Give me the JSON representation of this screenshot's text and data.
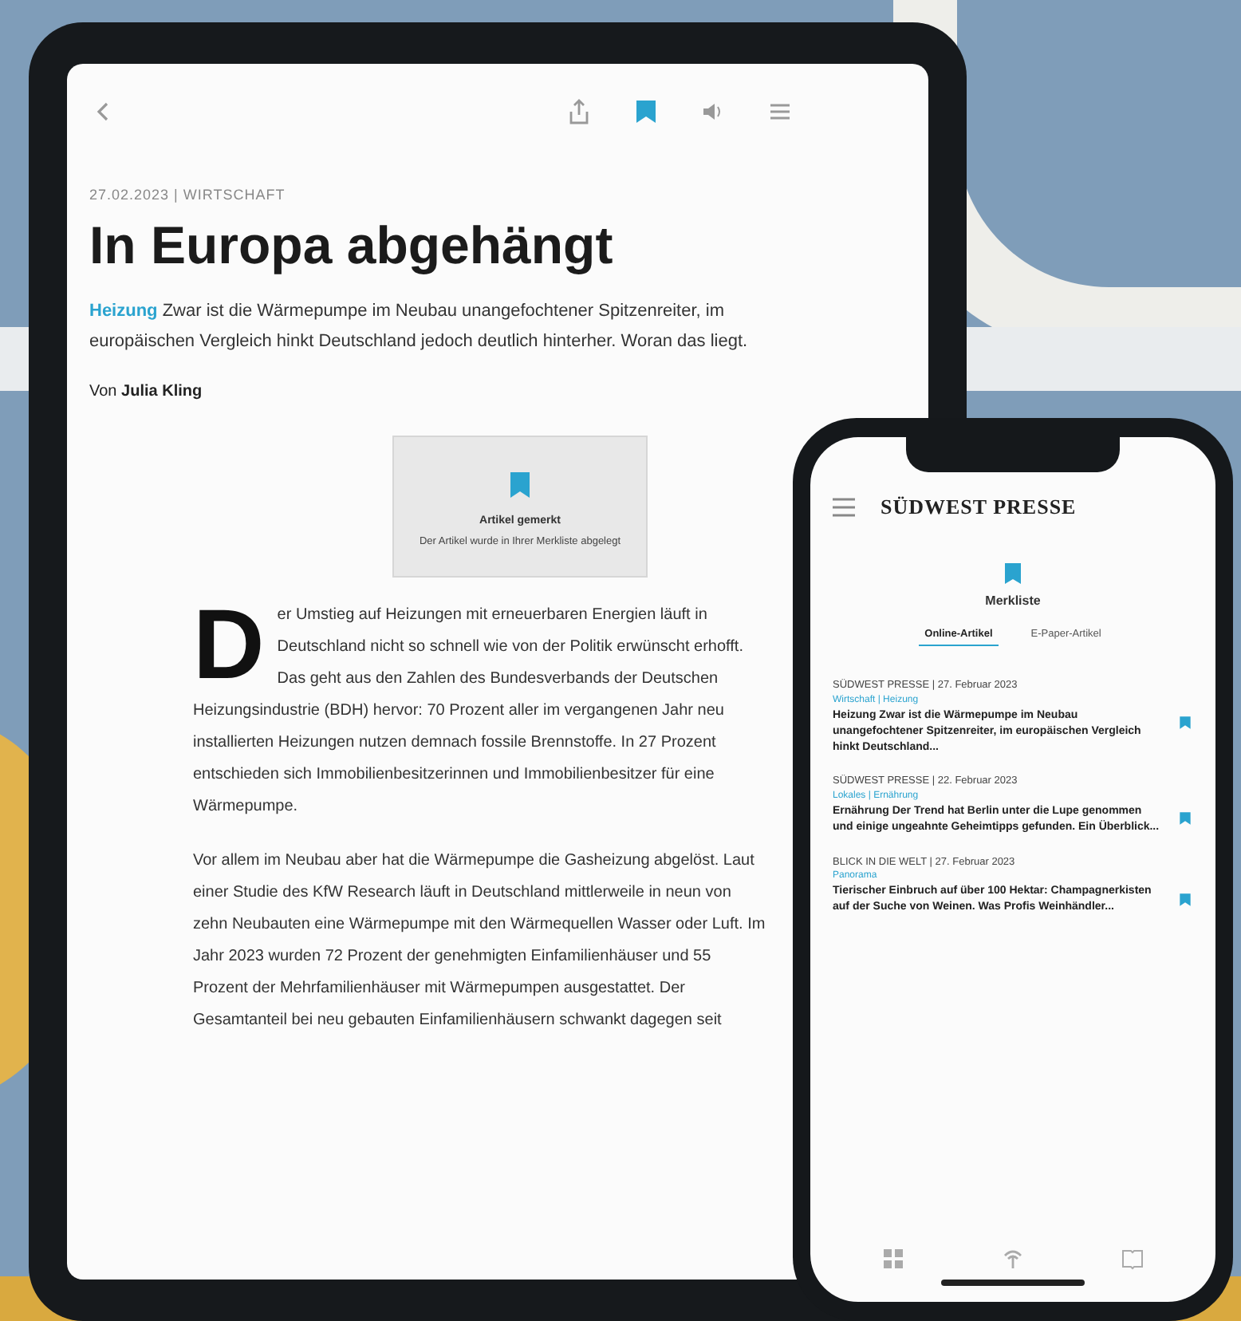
{
  "tablet": {
    "article": {
      "meta": "27.02.2023 | WIRTSCHAFT",
      "title": "In Europa abgehängt",
      "lead_tag": "Heizung",
      "lead": "Zwar ist die Wärmepumpe im Neubau unangefochtener Spitzenreiter, im europäischen Vergleich hinkt Deutschland jedoch deutlich hinterher. Woran das liegt.",
      "author": "Von **Julia Kling**",
      "toast": {
        "title": "Artikel gemerkt",
        "text": "Der Artikel wurde in Ihrer Merkliste abgelegt"
      },
      "dropcap": "D",
      "paragraphs": [
        "er Umstieg auf Heizungen mit erneuerbaren Energien läuft in Deutschland nicht so schnell wie von der Politik erwünscht erhofft. Das geht aus den Zahlen des Bundesverbands der Deutschen Heizungsindustrie (BDH) hervor: 70 Prozent aller im vergangenen Jahr neu installierten Heizungen nutzen demnach fossile Brennstoffe. In 27 Prozent entschieden sich Immobilienbesitzerinnen und Immobilienbesitzer für eine Wärmepumpe.",
        "Vor allem im Neubau aber hat die Wärmepumpe die Gasheizung abgelöst. Laut einer Studie des KfW Research läuft in Deutschland mittlerweile in neun von zehn Neubauten eine Wärmepumpe mit den Wärmequellen Wasser oder Luft. Im Jahr 2023 wurden 72 Prozent der genehmigten Einfamilienhäuser und 55 Prozent der Mehrfamilienhäuser mit Wärmepumpen ausgestattet. Der Gesamtanteil bei neu gebauten Einfamilienhäusern schwankt dagegen seit"
      ]
    },
    "bookmarked": true
  },
  "phone": {
    "logo": "SÜDWEST PRESSE",
    "page_title": "Merkliste",
    "tabs": [
      {
        "label": "Online-Artikel",
        "selected": true
      },
      {
        "label": "E-Paper-Artikel",
        "selected": false
      }
    ],
    "items": [
      {
        "source": "SÜDWEST PRESSE | 27. Februar 2023",
        "section": "Wirtschaft | Heizung",
        "headline": "Heizung Zwar ist die Wärmepumpe im Neubau unangefochtener Spitzenreiter, im europäischen Vergleich hinkt Deutschland...",
        "bookmarked": true
      },
      {
        "source": "SÜDWEST PRESSE | 22. Februar 2023",
        "section": "Lokales | Ernährung",
        "headline": "Ernährung Der Trend hat Berlin unter die Lupe genommen und einige ungeahnte Geheimtipps gefunden. Ein Überblick...",
        "bookmarked": true
      },
      {
        "source": "BLICK IN DIE WELT | 27. Februar 2023",
        "section": "Panorama",
        "headline": "Tierischer Einbruch auf über 100 Hektar: Champagnerkisten auf der Suche von Weinen. Was Profis Weinhändler...",
        "bookmarked": true
      }
    ]
  }
}
